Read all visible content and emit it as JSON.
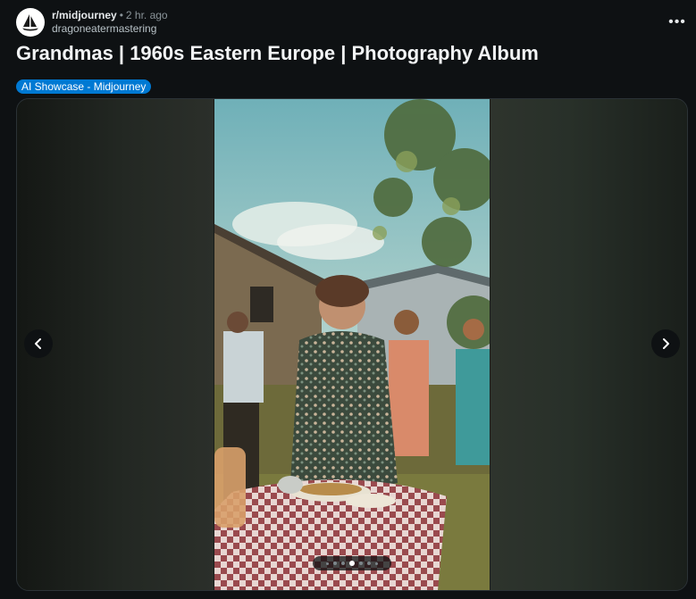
{
  "post": {
    "subreddit": "r/midjourney",
    "separator": "•",
    "time": "2 hr. ago",
    "author": "dragoneatermastering",
    "more_label": "•••",
    "title": "Grandmas | 1960s Eastern Europe | Photography Album",
    "flair": "AI Showcase - Midjourney"
  },
  "gallery": {
    "total_images": 7,
    "current_index": 4
  },
  "colors": {
    "background": "#0e1113",
    "flair": "#0079d3",
    "text_muted": "#8a9499"
  },
  "icons": {
    "avatar": "sailboat-logo",
    "prev": "chevron-left-icon",
    "next": "chevron-right-icon",
    "more": "ellipsis-icon"
  }
}
